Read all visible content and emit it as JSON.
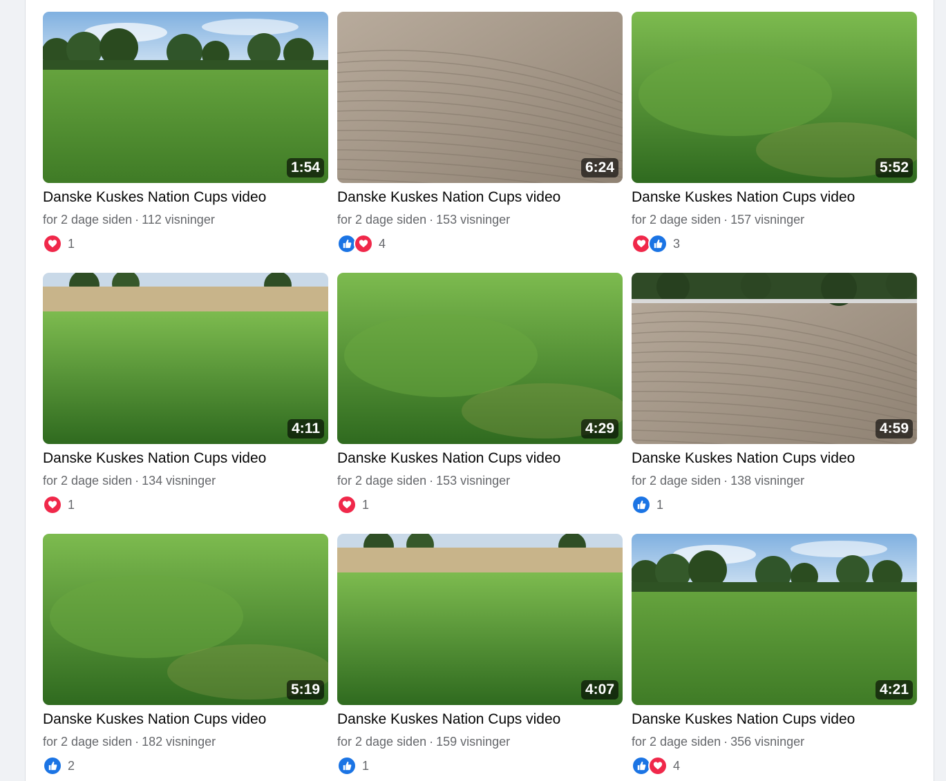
{
  "colors": {
    "like": "#1b74e4",
    "love": "#f0284a",
    "page_bg": "#f0f2f5"
  },
  "videos": [
    {
      "title": "Danske Kuskes Nation Cups video",
      "age": "for 2 dage siden",
      "views": "112 visninger",
      "duration": "1:54",
      "reactions": [
        "love"
      ],
      "reaction_count": "1",
      "scene": "trees"
    },
    {
      "title": "Danske Kuskes Nation Cups video",
      "age": "for 2 dage siden",
      "views": "153 visninger",
      "duration": "6:24",
      "reactions": [
        "like",
        "love"
      ],
      "reaction_count": "4",
      "scene": "sand"
    },
    {
      "title": "Danske Kuskes Nation Cups video",
      "age": "for 2 dage siden",
      "views": "157 visninger",
      "duration": "5:52",
      "reactions": [
        "love",
        "like"
      ],
      "reaction_count": "3",
      "scene": "grass"
    },
    {
      "title": "Danske Kuskes Nation Cups video",
      "age": "for 2 dage siden",
      "views": "134 visninger",
      "duration": "4:11",
      "reactions": [
        "love"
      ],
      "reaction_count": "1",
      "scene": "field"
    },
    {
      "title": "Danske Kuskes Nation Cups video",
      "age": "for 2 dage siden",
      "views": "153 visninger",
      "duration": "4:29",
      "reactions": [
        "love"
      ],
      "reaction_count": "1",
      "scene": "grass"
    },
    {
      "title": "Danske Kuskes Nation Cups video",
      "age": "for 2 dage siden",
      "views": "138 visninger",
      "duration": "4:59",
      "reactions": [
        "like"
      ],
      "reaction_count": "1",
      "scene": "sand-trees"
    },
    {
      "title": "Danske Kuskes Nation Cups video",
      "age": "for 2 dage siden",
      "views": "182 visninger",
      "duration": "5:19",
      "reactions": [
        "like"
      ],
      "reaction_count": "2",
      "scene": "grass"
    },
    {
      "title": "Danske Kuskes Nation Cups video",
      "age": "for 2 dage siden",
      "views": "159 visninger",
      "duration": "4:07",
      "reactions": [
        "like"
      ],
      "reaction_count": "1",
      "scene": "field"
    },
    {
      "title": "Danske Kuskes Nation Cups video",
      "age": "for 2 dage siden",
      "views": "356 visninger",
      "duration": "4:21",
      "reactions": [
        "like",
        "love"
      ],
      "reaction_count": "4",
      "scene": "trees"
    }
  ]
}
